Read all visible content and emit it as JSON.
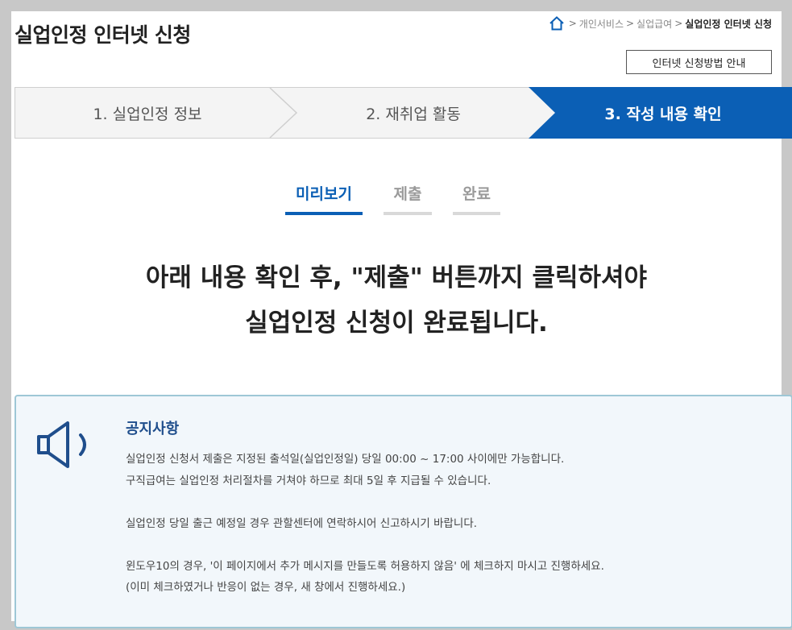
{
  "header": {
    "title": "실업인정 인터넷 신청",
    "breadcrumb": [
      "개인서비스",
      "실업급여",
      "실업인정 인터넷 신청"
    ],
    "guide_button": "인터넷 신청방법 안내"
  },
  "steps": [
    {
      "label": "1. 실업인정 정보"
    },
    {
      "label": "2. 재취업 활동"
    },
    {
      "label": "3. 작성 내용 확인"
    }
  ],
  "tabs": [
    {
      "label": "미리보기"
    },
    {
      "label": "제출"
    },
    {
      "label": "완료"
    }
  ],
  "headline": {
    "line1": "아래 내용 확인 후, \"제출\" 버튼까지 클릭하셔야",
    "line2": "실업인정 신청이 완료됩니다."
  },
  "notice": {
    "title": "공지사항",
    "lines": [
      "실업인정 신청서 제출은 지정된 출석일(실업인정일) 당일 00:00 ~ 17:00 사이에만 가능합니다.",
      "구직급여는 실업인정 처리절차를 거쳐야 하므로 최대 5일 후 지급될 수 있습니다.",
      "",
      "실업인정 당일 출근 예정일 경우 관할센터에 연락하시어 신고하시기 바랍니다.",
      "",
      "윈도우10의 경우, '이 페이지에서 추가 메시지를 만들도록 허용하지 않음' 에 체크하지 마시고 진행하세요.",
      "(이미 체크하였거나 반응이 없는 경우, 새 창에서 진행하세요.)"
    ]
  },
  "colors": {
    "accent": "#0b5fb5",
    "step_inactive_bg": "#f4f4f4",
    "notice_bg": "#f2f7fb",
    "notice_border": "#9ec7d6",
    "notice_title": "#1f4e8c"
  },
  "icons": [
    "home-icon",
    "speaker-icon"
  ]
}
